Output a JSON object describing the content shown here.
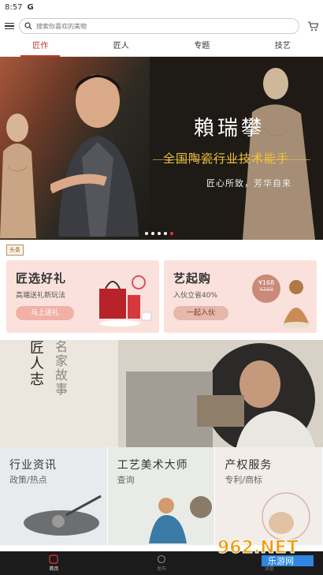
{
  "status": {
    "time": "8:57",
    "carrier_icon": "G"
  },
  "search": {
    "placeholder": "搜索你喜欢的美物"
  },
  "tabs": [
    {
      "label": "匠作",
      "active": true
    },
    {
      "label": "匠人",
      "active": false
    },
    {
      "label": "专题",
      "active": false
    },
    {
      "label": "技艺",
      "active": false
    }
  ],
  "banner": {
    "name": "賴瑞攀",
    "title": "全国陶瓷行业技术能手",
    "motto": "匠心所致，芳华自来",
    "slides": 5,
    "active_slide": 5
  },
  "news": {
    "tag": "头条"
  },
  "promos": [
    {
      "heading": "匠选好礼",
      "sub": "高端送礼新玩法",
      "button": "马上送礼"
    },
    {
      "heading": "艺起购",
      "sub": "入伙立省40%",
      "button": "一起入伙",
      "price": "¥168",
      "old_price": "¥268"
    }
  ],
  "story": {
    "title": "匠人志",
    "subtitle": "名家故事"
  },
  "services": [
    {
      "heading": "行业资讯",
      "sub": "政策/热点"
    },
    {
      "heading": "工艺美术大师",
      "sub": "查询"
    },
    {
      "heading": "产权服务",
      "sub": "专利/商标"
    }
  ],
  "bottom_nav": [
    {
      "label": "首页",
      "icon": "home-icon",
      "active": true
    },
    {
      "label": "发布",
      "icon": "publish-icon",
      "active": false
    },
    {
      "label": "消息",
      "icon": "bell-icon",
      "active": false
    }
  ],
  "watermark": {
    "text": "962.NET",
    "sub": "乐游网"
  },
  "colors": {
    "accent": "#c0392b",
    "gold": "#f0c33c",
    "promo_bg": "#fbe1dc"
  }
}
